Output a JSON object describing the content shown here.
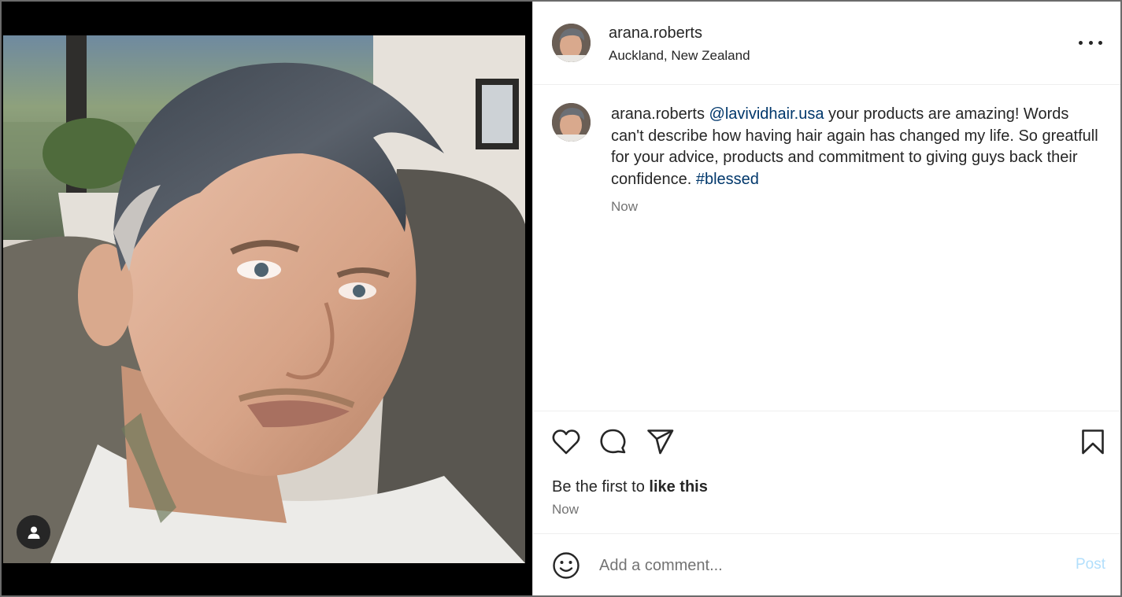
{
  "post": {
    "username": "arana.roberts",
    "location": "Auckland, New Zealand",
    "more_icon": "more-horizontal-icon"
  },
  "caption": {
    "username": "arana.roberts",
    "mention": "@lavividhair.usa",
    "text_part1": " your products are amazing! Words can't describe how having hair again has changed my life. So greatfull for your advice, products and commitment to giving guys back their confidence. ",
    "hashtag": "#blessed",
    "time": "Now"
  },
  "actions": {
    "like_icon": "heart-icon",
    "comment_icon": "comment-icon",
    "share_icon": "paper-plane-icon",
    "save_icon": "bookmark-icon",
    "likes_prefix": "Be the first to ",
    "likes_action": "like this",
    "time": "Now"
  },
  "composer": {
    "emoji_icon": "emoji-icon",
    "placeholder": "Add a comment...",
    "post_label": "Post"
  },
  "media": {
    "tag_icon": "user-tag-icon"
  },
  "colors": {
    "link": "#00376b",
    "muted": "#737373",
    "post_disabled": "#b2dffc",
    "text": "#262626"
  }
}
